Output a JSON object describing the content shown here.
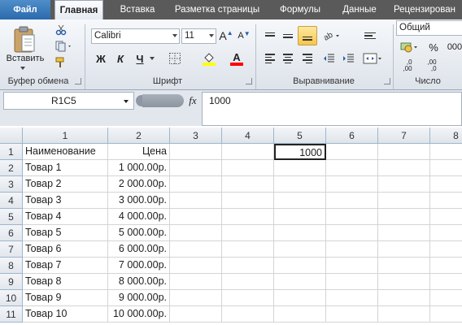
{
  "tabs": [
    {
      "label": "Файл",
      "kind": "file"
    },
    {
      "label": "Главная",
      "kind": "active"
    },
    {
      "label": "Вставка",
      "kind": ""
    },
    {
      "label": "Разметка страницы",
      "kind": ""
    },
    {
      "label": "Формулы",
      "kind": ""
    },
    {
      "label": "Данные",
      "kind": ""
    },
    {
      "label": "Рецензирован",
      "kind": ""
    }
  ],
  "ribbon": {
    "clipboard": {
      "paste_label": "Вставить",
      "group_label": "Буфер обмена"
    },
    "font": {
      "font_name": "Calibri",
      "font_size": "11",
      "grow_label": "A",
      "shrink_label": "A",
      "bold_label": "Ж",
      "italic_label": "К",
      "underline_label": "Ч",
      "font_color_label": "A",
      "group_label": "Шрифт",
      "highlight_color": "#ffff00",
      "font_color": "#ff0000"
    },
    "alignment": {
      "group_label": "Выравнивание"
    },
    "number": {
      "format": "Общий",
      "percent_label": "%",
      "comma_label": "000",
      "increase_decimal_label": ",0\n,00",
      "decrease_decimal_label": ",00\n,0",
      "group_label": "Число"
    }
  },
  "formula_bar": {
    "name_box": "R1C5",
    "fx_label": "fx",
    "formula": "1000"
  },
  "grid": {
    "columns": [
      "1",
      "2",
      "3",
      "4",
      "5",
      "6",
      "7",
      "8"
    ],
    "rows": [
      {
        "num": "1",
        "c1": "Наименование",
        "c2": "Цена",
        "c5": "1000"
      },
      {
        "num": "2",
        "c1": "Товар 1",
        "c2": "1 000.00р.",
        "c5": ""
      },
      {
        "num": "3",
        "c1": "Товар 2",
        "c2": "2 000.00р.",
        "c5": ""
      },
      {
        "num": "4",
        "c1": "Товар 3",
        "c2": "3 000.00р.",
        "c5": ""
      },
      {
        "num": "5",
        "c1": "Товар 4",
        "c2": "4 000.00р.",
        "c5": ""
      },
      {
        "num": "6",
        "c1": "Товар 5",
        "c2": "5 000.00р.",
        "c5": ""
      },
      {
        "num": "7",
        "c1": "Товар 6",
        "c2": "6 000.00р.",
        "c5": ""
      },
      {
        "num": "8",
        "c1": "Товар 7",
        "c2": "7 000.00р.",
        "c5": ""
      },
      {
        "num": "9",
        "c1": "Товар 8",
        "c2": "8 000.00р.",
        "c5": ""
      },
      {
        "num": "10",
        "c1": "Товар 9",
        "c2": "9 000.00р.",
        "c5": ""
      },
      {
        "num": "11",
        "c1": "Товар 10",
        "c2": "10 000.00р.",
        "c5": ""
      }
    ]
  },
  "colors": {
    "tabbar": "#5a5a5a",
    "file_tab": "#2b6aad",
    "selection": "#222222"
  }
}
